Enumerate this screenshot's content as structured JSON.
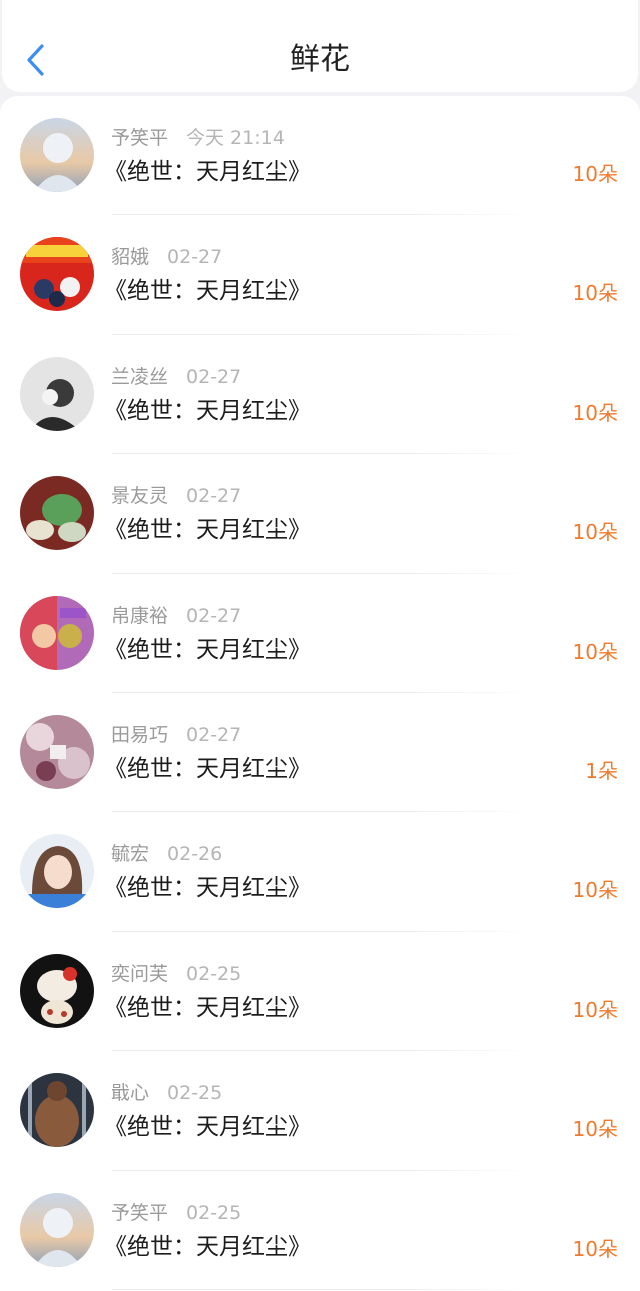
{
  "header": {
    "title": "鲜花",
    "back_icon": "chevron-left-icon",
    "accent_color": "#3a8ff0"
  },
  "colors": {
    "flower_count": "#f07a2e",
    "name": "#9a9a9a"
  },
  "records": [
    {
      "user": "予笑平",
      "time": "今天 21:14",
      "book": "《绝世：天月红尘》",
      "flowers": "10朵",
      "avatar": "avatar-sky-anime"
    },
    {
      "user": "貂娥",
      "time": "02-27",
      "book": "《绝世：天月红尘》",
      "flowers": "10朵",
      "avatar": "avatar-army-day"
    },
    {
      "user": "兰凌丝",
      "time": "02-27",
      "book": "《绝世：天月红尘》",
      "flowers": "10朵",
      "avatar": "avatar-sketch"
    },
    {
      "user": "景友灵",
      "time": "02-27",
      "book": "《绝世：天月红尘》",
      "flowers": "10朵",
      "avatar": "avatar-jade"
    },
    {
      "user": "帛康裕",
      "time": "02-27",
      "book": "《绝世：天月红尘》",
      "flowers": "10朵",
      "avatar": "avatar-comic"
    },
    {
      "user": "田易巧",
      "time": "02-27",
      "book": "《绝世：天月红尘》",
      "flowers": "1朵",
      "avatar": "avatar-floral"
    },
    {
      "user": "毓宏",
      "time": "02-26",
      "book": "《绝世：天月红尘》",
      "flowers": "10朵",
      "avatar": "avatar-girl"
    },
    {
      "user": "奕问芙",
      "time": "02-25",
      "book": "《绝世：天月红尘》",
      "flowers": "10朵",
      "avatar": "avatar-cat"
    },
    {
      "user": "戢心",
      "time": "02-25",
      "book": "《绝世：天月红尘》",
      "flowers": "10朵",
      "avatar": "avatar-muscle"
    },
    {
      "user": "予笑平",
      "time": "02-25",
      "book": "《绝世：天月红尘》",
      "flowers": "10朵",
      "avatar": "avatar-sky-anime"
    }
  ]
}
